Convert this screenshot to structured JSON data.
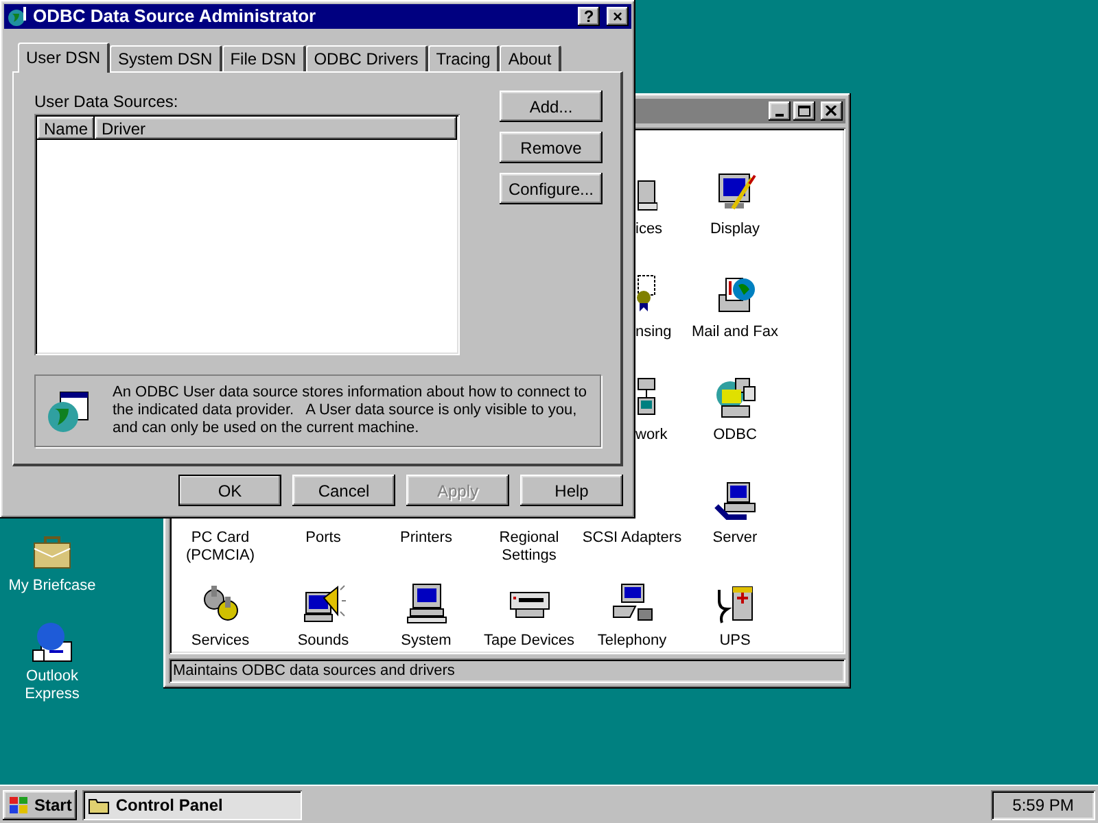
{
  "desktop_icons": [
    {
      "label": "My Briefcase",
      "kind": "briefcase"
    },
    {
      "label": "Outlook Express",
      "kind": "mail"
    }
  ],
  "control_panel": {
    "rows": [
      [
        {
          "label": "ices",
          "kind": "device"
        },
        {
          "label": "Display",
          "kind": "display"
        }
      ],
      [
        {
          "label": "nsing",
          "kind": "license"
        },
        {
          "label": "Mail and Fax",
          "kind": "mailfax"
        }
      ],
      [
        {
          "label": "work",
          "kind": "network"
        },
        {
          "label": "ODBC",
          "kind": "odbc"
        }
      ],
      [
        {
          "label": "PC Card (PCMCIA)",
          "kind": "none"
        },
        {
          "label": "Ports",
          "kind": "none"
        },
        {
          "label": "Printers",
          "kind": "none"
        },
        {
          "label": "Regional Settings",
          "kind": "none"
        },
        {
          "label": "SCSI Adapters",
          "kind": "none"
        },
        {
          "label": "Server",
          "kind": "server"
        }
      ],
      [
        {
          "label": "Services",
          "kind": "services"
        },
        {
          "label": "Sounds",
          "kind": "sounds"
        },
        {
          "label": "System",
          "kind": "system"
        },
        {
          "label": "Tape Devices",
          "kind": "tape"
        },
        {
          "label": "Telephony",
          "kind": "telephony"
        },
        {
          "label": "UPS",
          "kind": "ups"
        }
      ]
    ],
    "status_bar": "Maintains ODBC data sources and drivers"
  },
  "dialog": {
    "title": "ODBC Data Source Administrator",
    "title_buttons": [
      "?",
      "×"
    ],
    "tabs": [
      {
        "label": "User DSN",
        "selected": true
      },
      {
        "label": "System DSN",
        "selected": false
      },
      {
        "label": "File DSN",
        "selected": false
      },
      {
        "label": "ODBC Drivers",
        "selected": false
      },
      {
        "label": "Tracing",
        "selected": false
      },
      {
        "label": "About",
        "selected": false
      }
    ],
    "list_label": "User Data Sources:",
    "columns": [
      "Name",
      "Driver"
    ],
    "side_buttons": [
      "Add...",
      "Remove",
      "Configure..."
    ],
    "info": "An ODBC User data source stores information about how to connect to the indicated data provider.   A User data source is only visible to you, and can only be used on the current machine.",
    "buttons": [
      {
        "label": "OK",
        "default": true,
        "disabled": false
      },
      {
        "label": "Cancel",
        "default": false,
        "disabled": false
      },
      {
        "label": "Apply",
        "default": false,
        "disabled": true
      },
      {
        "label": "Help",
        "default": false,
        "disabled": false
      }
    ]
  },
  "taskbar": {
    "start": "Start",
    "tasks": [
      {
        "label": "Control Panel",
        "selected": true
      }
    ],
    "clock": "5:59 PM"
  }
}
